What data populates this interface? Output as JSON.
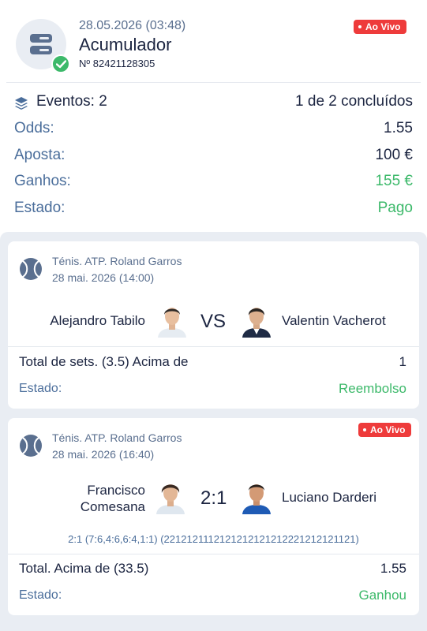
{
  "header": {
    "date": "28.05.2026 (03:48)",
    "title": "Acumulador",
    "number": "Nº 82421128305",
    "live_label": "Ao Vivo",
    "icon": "coupon-icon"
  },
  "summary": {
    "events_label": "Eventos: 2",
    "events_value": "1 de 2 concluídos",
    "odds_label": "Odds:",
    "odds_value": "1.55",
    "stake_label": "Aposta:",
    "stake_value": "100 €",
    "winnings_label": "Ganhos:",
    "winnings_value": "155 €",
    "state_label": "Estado:",
    "state_value": "Pago"
  },
  "events": [
    {
      "league": "Ténis. ATP. Roland Garros",
      "date": "28 mai. 2026 (14:00)",
      "player1": "Alejandro Tabilo",
      "player2": "Valentin Vacherot",
      "center": "VS",
      "market": "Total de sets. (3.5) Acima de",
      "market_value": "1",
      "state_label": "Estado:",
      "state_value": "Reembolso"
    },
    {
      "league": "Ténis. ATP. Roland Garros",
      "date": "28 mai. 2026 (16:40)",
      "live_label": "Ao Vivo",
      "player1_line1": "Francisco",
      "player1_line2": "Comesana",
      "player2": "Luciano Darderi",
      "center": "2:1",
      "score_detail": "2:1 (7:6,4:6,6:4,1:1) (2212121112121212121212221212121121)",
      "market": "Total. Acima de (33.5)",
      "market_value": "1.55",
      "state_label": "Estado:",
      "state_value": "Ganhou"
    }
  ],
  "colors": {
    "accent_text": "#1c2541",
    "muted_text": "#4b6e9b",
    "success": "#3cb96a",
    "live": "#ee3b3b",
    "panel_bg": "#e9edf3"
  }
}
